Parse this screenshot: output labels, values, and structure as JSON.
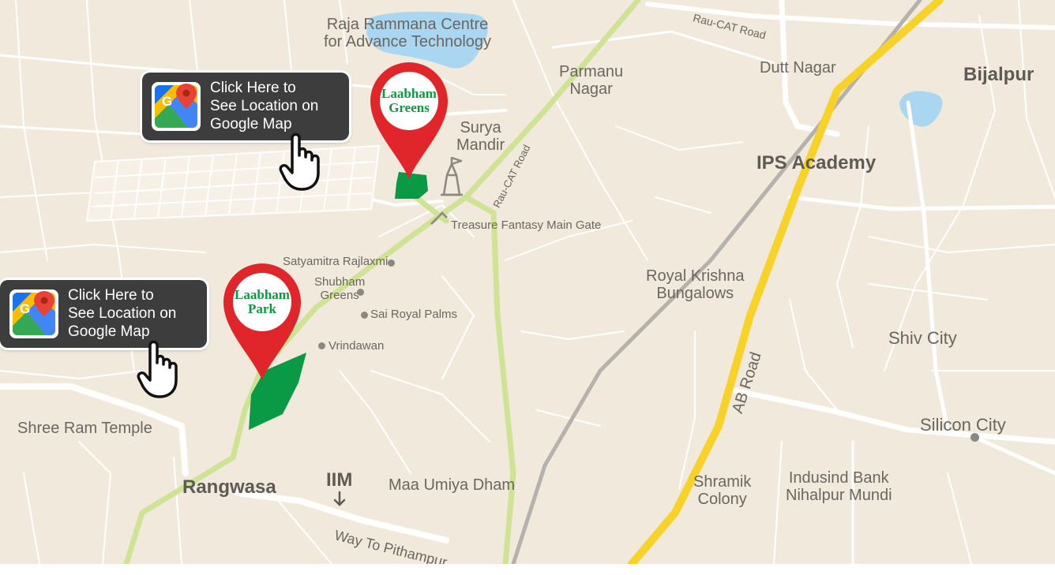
{
  "map": {
    "colors": {
      "land": "#f1e9dc",
      "minor_road": "#ffffff",
      "water": "#a9d6f0",
      "highway": "#f7d32a",
      "green_road": "#cfe394",
      "rail": "#b5b2ae",
      "plot": "#0a9a46",
      "pin": "#e0262b",
      "label": "#6a6660"
    },
    "labels": {
      "raja_rammana": [
        "Raja Rammana Centre",
        "for Advance Technology"
      ],
      "rau_cat_road_top": "Rau-CAT Road",
      "parmanu_nagar": [
        "Parmanu",
        "Nagar"
      ],
      "dutt_nagar": "Dutt Nagar",
      "bijalpur": "Bijalpur",
      "surya_mandir": [
        "Surya",
        "Mandir"
      ],
      "ips_academy": "IPS Academy",
      "rau_cat_road_side": "Rau-CAT Road",
      "treasure_fantasy": "Treasure Fantasy Main Gate",
      "satyamitra": "Satyamitra Rajlaxmi",
      "shubham_greens": [
        "Shubham",
        "Greens"
      ],
      "sai_royal_palms": "Sai Royal Palms",
      "vrindawan": "Vrindawan",
      "royal_krishna": [
        "Royal Krishna",
        "Bungalows"
      ],
      "shiv_city": "Shiv City",
      "ab_road": "AB Road",
      "shree_ram_temple": "Shree Ram Temple",
      "silicon_city": "Silicon City",
      "rangwasa": "Rangwasa",
      "iim": "IIM",
      "maa_umiya_dham": "Maa Umiya Dham",
      "shramik_colony": [
        "Shramik",
        "Colony"
      ],
      "indusind_bank": [
        "Indusind Bank",
        "Nihalpur Mundi"
      ],
      "way_to_pithampur": "Way To Pithampur"
    },
    "pins": {
      "greens": [
        "Laabham",
        "Greens"
      ],
      "park": [
        "Laabham",
        "Park"
      ]
    },
    "buttons": {
      "greens": [
        "Click Here to",
        "See Location on",
        "Google Map"
      ],
      "park": [
        "Click Here to",
        "See Location on",
        "Google Map"
      ]
    },
    "icons": {
      "google_maps": "google-maps-icon",
      "hand": "hand-pointer-icon",
      "temple": "temple-icon",
      "gate": "gate-icon",
      "arrow": "arrow-down-icon"
    }
  }
}
